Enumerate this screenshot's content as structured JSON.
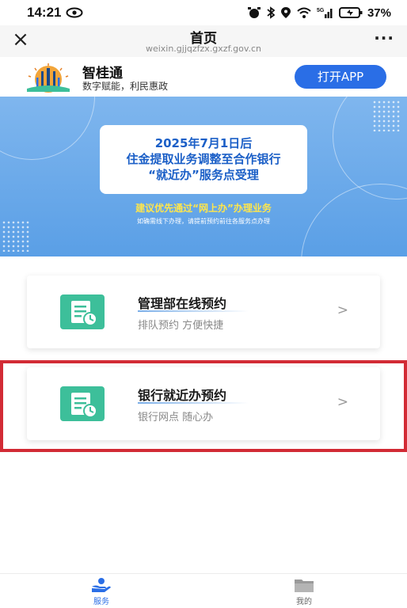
{
  "status_bar": {
    "time": "14:21",
    "battery": "37%"
  },
  "nav": {
    "title": "首页",
    "url": "weixin.gjjqzfzx.gxzf.gov.cn",
    "close_icon": "×",
    "more_icon": "···"
  },
  "app_banner": {
    "name": "智桂通",
    "slogan": "数字赋能，利民惠政",
    "open_button": "打开APP"
  },
  "hero": {
    "line1": "2025年7月1日后",
    "line2": "住金提取业务调整至合作银行",
    "line3": "“就近办”服务点受理",
    "subtitle": "建议优先通过“网上办”办理业务",
    "note": "如确需线下办理，请提前预约前往各服务点办理",
    "colors": {
      "bg_top": "#7fb6ee",
      "bg_bottom": "#5a9fe6",
      "card_text": "#1b5fc7",
      "subtitle": "#ffe64b"
    }
  },
  "services": [
    {
      "title": "管理部在线预约",
      "desc": "排队预约 方便快捷",
      "arrow": ">"
    },
    {
      "title": "银行就近办预约",
      "desc": "银行网点 随心办",
      "arrow": ">"
    }
  ],
  "tabs": [
    {
      "label": "服务",
      "icon": "hand-service-icon",
      "active": true
    },
    {
      "label": "我的",
      "icon": "folder-icon",
      "active": false
    }
  ],
  "accent_color": "#2a6ee6",
  "highlight_color": "#d22b35",
  "icon_color": "#3dbf9a"
}
